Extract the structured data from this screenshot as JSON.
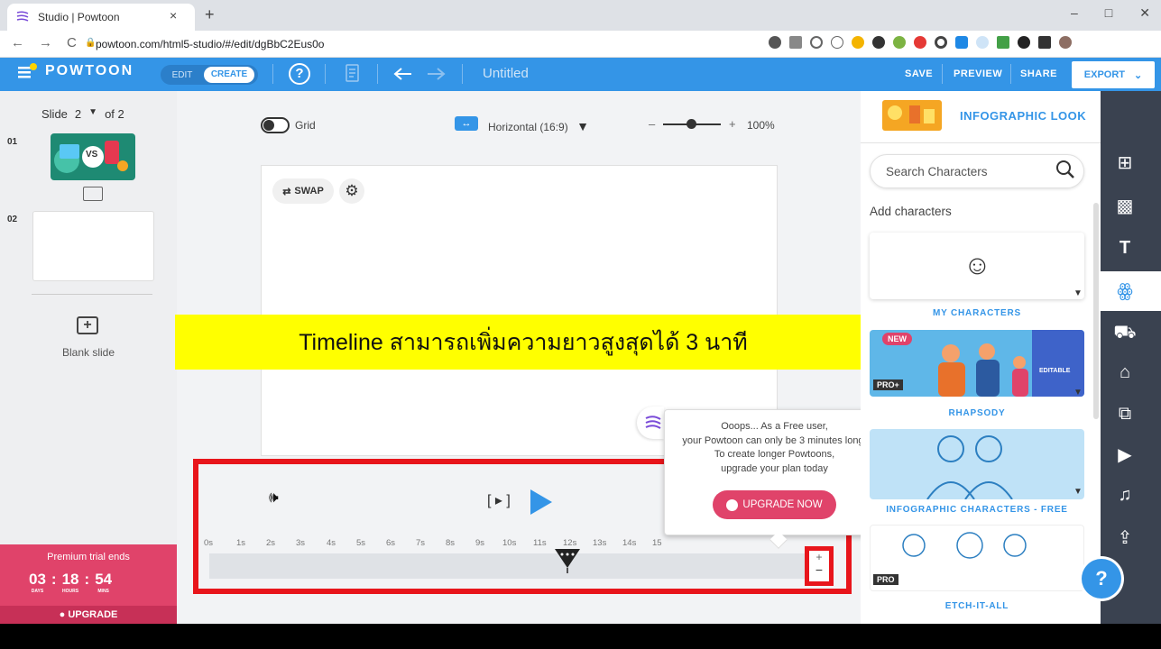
{
  "browser": {
    "tab_title": "Studio | Powtoon",
    "tab_close": "×",
    "new_tab": "+",
    "url": "powtoon.com/html5-studio/#/edit/dgBbC2Eus0o",
    "nav": [
      "←",
      "→",
      "C"
    ],
    "window_controls": [
      "–",
      "□",
      "✕"
    ]
  },
  "appbar": {
    "logo": "POWTOON",
    "mode_edit": "EDIT",
    "mode_create": "CREATE",
    "help": "?",
    "title": "Untitled",
    "save": "SAVE",
    "preview": "PREVIEW",
    "share": "SHARE",
    "export": "EXPORT",
    "export_caret": "⌄"
  },
  "left_panel": {
    "slide_label": "Slide",
    "slide_current": "2",
    "slide_caret": "▼",
    "slide_of": "of 2",
    "slide1_num": "01",
    "slide1_thumb_text": "VS",
    "slide2_num": "02",
    "blank_slide_icon": "+",
    "blank_slide_label": "Blank slide"
  },
  "premium": {
    "title": "Premium trial ends",
    "days": "03",
    "hours": "18",
    "mins": "54",
    "days_label": "DAYS",
    "hours_label": "HOURS",
    "mins_label": "MINS",
    "sep": ":",
    "upgrade": "UPGRADE"
  },
  "toolbar": {
    "grid_label": "Grid",
    "orientation_label": "Horizontal (16:9)",
    "orientation_caret": "▼",
    "orientation_icon": "↔",
    "zoom_minus": "–",
    "zoom_plus": "+",
    "zoom_value": "100%"
  },
  "slide": {
    "swap_label": "SWAP",
    "swap_icon": "⇄",
    "gear_icon": "⚙"
  },
  "banner": {
    "text": "Timeline สามารถเพิ่มความยาวสูงสุดได้ 3 นาที"
  },
  "timeline": {
    "volume_icon": "🕪",
    "play_frame": "[ ▸ ]",
    "ticks": [
      "0s",
      "1s",
      "2s",
      "3s",
      "4s",
      "5s",
      "6s",
      "7s",
      "8s",
      "9s",
      "10s",
      "11s",
      "12s",
      "13s",
      "14s",
      "15"
    ],
    "zoom_plus": "+",
    "zoom_minus": "−"
  },
  "popup": {
    "line1": "Ooops... As a Free user,",
    "line2": "your Powtoon can only be 3 minutes long.",
    "line3": "To create longer Powtoons,",
    "line4": "upgrade your plan today",
    "button": "UPGRADE NOW"
  },
  "right_panel": {
    "look_label": "INFOGRAPHIC LOOK",
    "look_caret": "▼",
    "search_placeholder": "Search Characters",
    "add_characters": "Add characters",
    "my_characters_icon": "☺",
    "cards": [
      {
        "label": "MY CHARACTERS"
      },
      {
        "label": "RHAPSODY",
        "badge_new": "NEW",
        "badge_pro": "PRO+",
        "editable": "EDITABLE"
      },
      {
        "label": "INFOGRAPHIC CHARACTERS - FREE"
      },
      {
        "label": "ETCH-IT-ALL",
        "badge_pro": "PRO"
      }
    ]
  },
  "sidebar_icons": [
    "layout-icon",
    "pattern-icon",
    "text-icon",
    "characters-icon",
    "props-icon",
    "shapes-icon",
    "media-icon",
    "video-icon",
    "music-icon",
    "upload-icon"
  ],
  "sidebar_glyphs": [
    "⊞",
    "▩",
    "T",
    "ꙮ",
    "⛟",
    "⌂",
    "⧉",
    "▶",
    "♫",
    "⇪"
  ],
  "fab": "?",
  "colors": {
    "brand_blue": "#3495e7",
    "premium_pink": "#e0436a",
    "highlight_red": "#e8151b",
    "banner_yellow": "#ffff00",
    "sidebar_dark": "#3a4250"
  }
}
